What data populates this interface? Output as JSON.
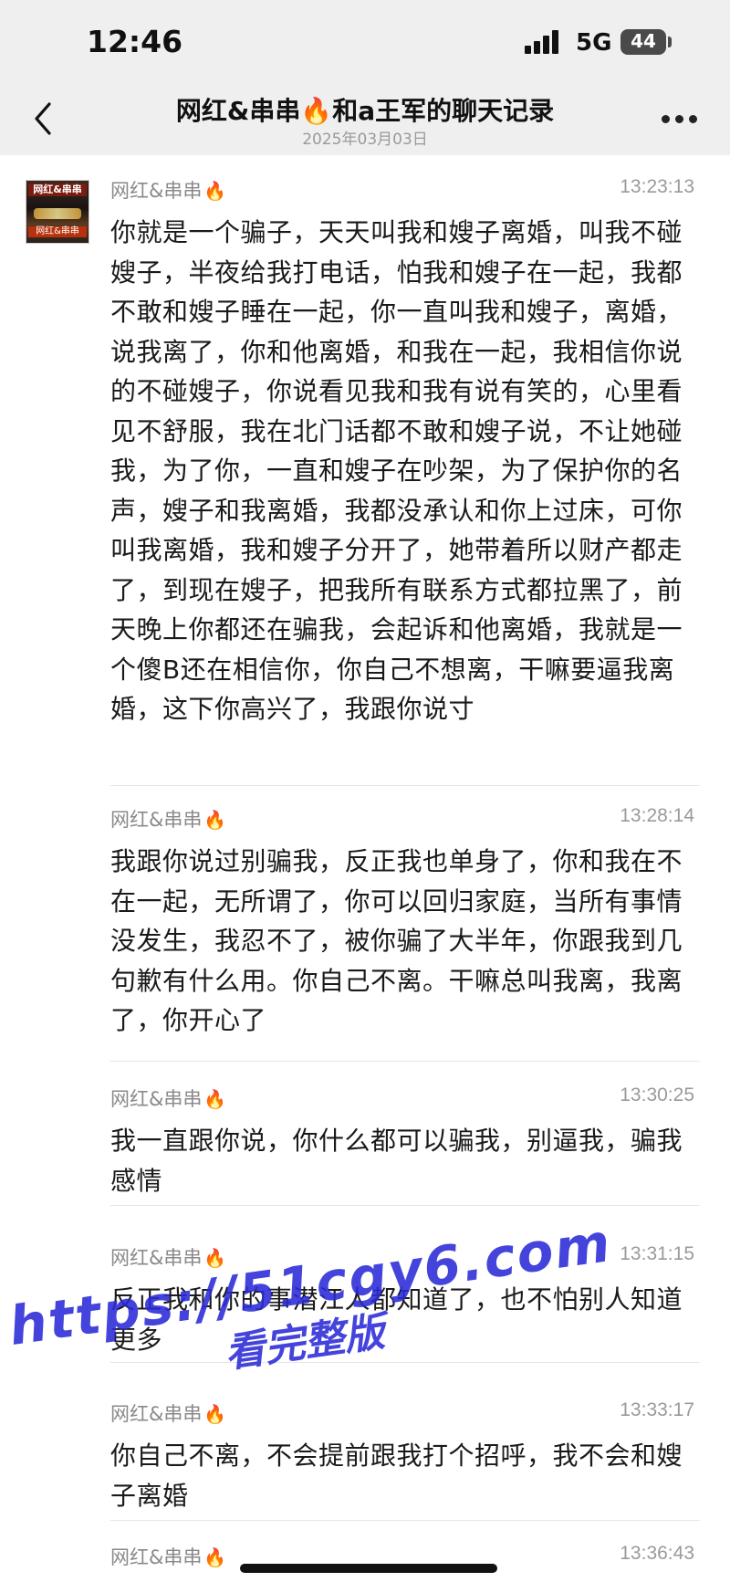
{
  "status_bar": {
    "time": "12:46",
    "network": "5G",
    "battery": "44"
  },
  "nav": {
    "title": "网红&串串🔥和a王军的聊天记录",
    "subtitle": "2025年03月03日"
  },
  "messages": [
    {
      "sender": "网红&串串",
      "time": "13:23:13",
      "text": "你就是一个骗子，天天叫我和嫂子离婚，叫我不碰嫂子，半夜给我打电话，怕我和嫂子在一起，我都不敢和嫂子睡在一起，你一直叫我和嫂子，离婚，说我离了，你和他离婚，和我在一起，我相信你说的不碰嫂子，你说看见我和我有说有笑的，心里看见不舒服，我在北门话都不敢和嫂子说，不让她碰我，为了你，一直和嫂子在吵架，为了保护你的名声，嫂子和我离婚，我都没承认和你上过床，可你叫我离婚，我和嫂子分开了，她带着所以财产都走了，到现在嫂子，把我所有联系方式都拉黑了，前天晚上你都还在骗我，会起诉和他离婚，我就是一个傻B还在相信你，你自己不想离，干嘛要逼我离婚，这下你高兴了，我跟你说寸"
    },
    {
      "sender": "网红&串串",
      "time": "13:28:14",
      "text": "我跟你说过别骗我，反正我也单身了，你和我在不在一起，无所谓了，你可以回归家庭，当所有事情没发生，我忍不了，被你骗了大半年，你跟我到几句歉有什么用。你自己不离。干嘛总叫我离，我离了，你开心了"
    },
    {
      "sender": "网红&串串",
      "time": "13:30:25",
      "text": "我一直跟你说，你什么都可以骗我，别逼我，骗我感情"
    },
    {
      "sender": "网红&串串",
      "time": "13:31:15",
      "text": "反正我和你的事潜江人都知道了，也不怕别人知道更多"
    },
    {
      "sender": "网红&串串",
      "time": "13:33:17",
      "text": "你自己不离，不会提前跟我打个招呼，我不会和嫂子离婚"
    },
    {
      "sender": "网红&串串",
      "time": "13:36:43",
      "text": ""
    }
  ],
  "avatar": {
    "sign_top": "网红&串串",
    "sign_bottom": "网红&串串"
  },
  "watermark": {
    "url": "https://51cgy6.com",
    "text": "看完整版"
  },
  "colors": {
    "background": "#ffffff",
    "header": "#efefef",
    "text": "#1a1a1a",
    "meta": "#9a9a9a",
    "watermark": "#2b2bd8"
  }
}
